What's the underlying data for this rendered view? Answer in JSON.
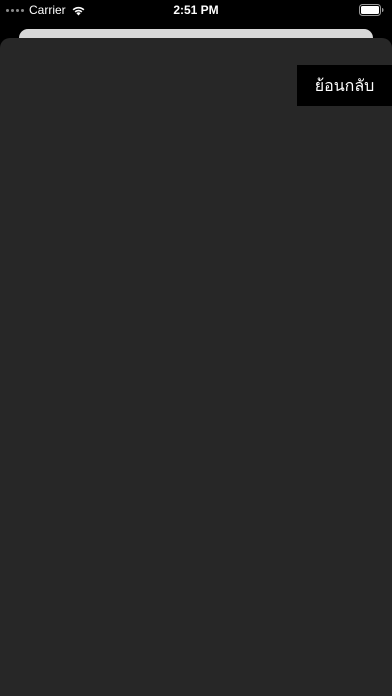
{
  "status_bar": {
    "carrier": "Carrier",
    "time": "2:51 PM",
    "icons": [
      "signal-dots-icon",
      "wifi-icon",
      "battery-icon"
    ]
  },
  "sheet": {
    "back_button_label": "ย้อนกลับ"
  },
  "colors": {
    "background": "#000000",
    "sheet": "#272727",
    "back_sheet": "#d8d8d8",
    "button_bg": "#000000",
    "text": "#ffffff"
  }
}
